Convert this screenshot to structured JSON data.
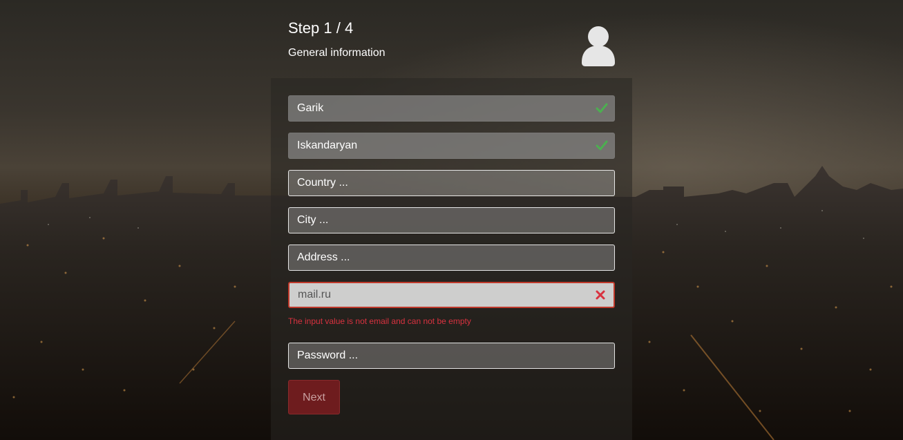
{
  "header": {
    "step": "Step 1 / 4",
    "subtitle": "General information"
  },
  "form": {
    "first_name": {
      "value": "Garik",
      "status": "valid"
    },
    "last_name": {
      "value": "Iskandaryan",
      "status": "valid"
    },
    "country": {
      "placeholder": "Country ..."
    },
    "city": {
      "placeholder": "City ..."
    },
    "address": {
      "placeholder": "Address ..."
    },
    "email": {
      "value": "mail.ru",
      "status": "error",
      "error_message": "The input value is not email and can not be empty"
    },
    "password": {
      "placeholder": "Password ..."
    }
  },
  "actions": {
    "next_label": "Next"
  },
  "icons": {
    "avatar": "user-icon",
    "valid": "check-icon",
    "invalid": "cross-icon"
  },
  "colors": {
    "valid": "#4caf50",
    "error": "#d9323f",
    "next_button": "#6e1c1e"
  }
}
